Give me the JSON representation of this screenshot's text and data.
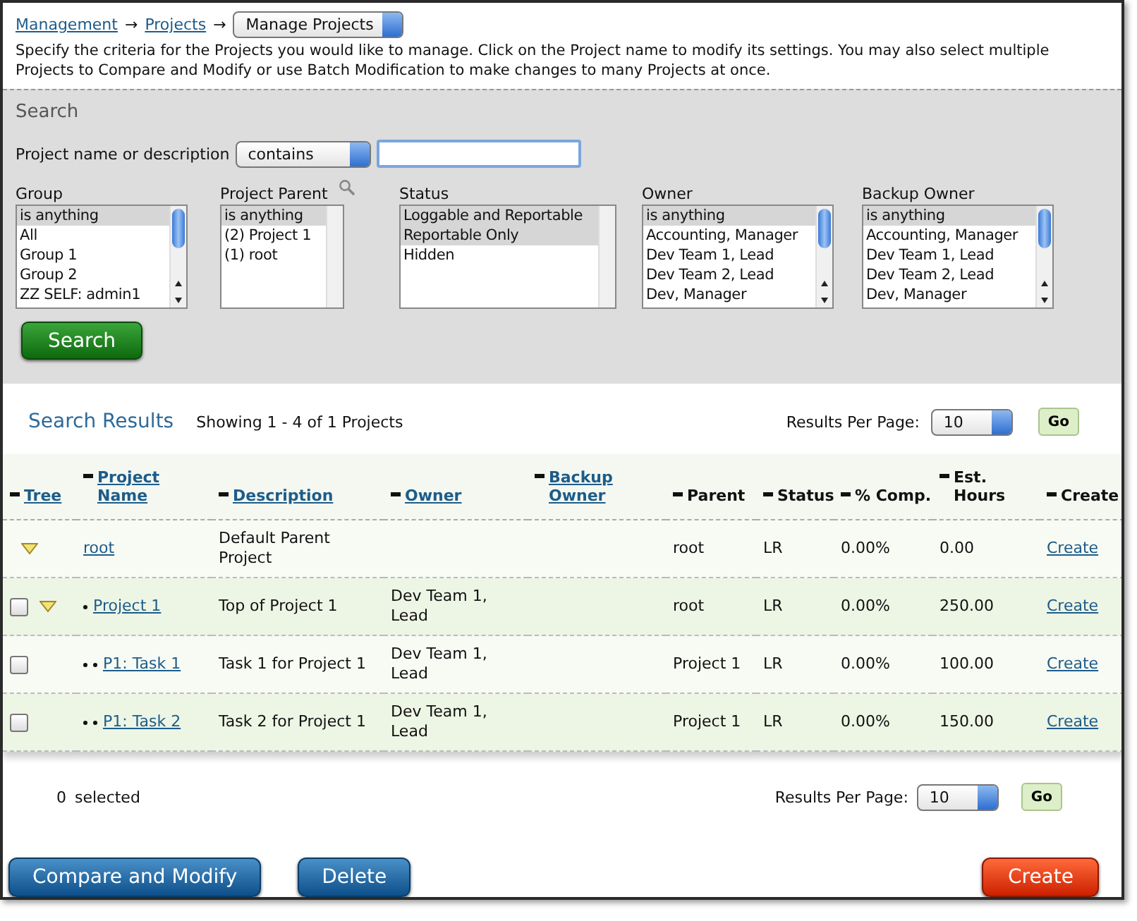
{
  "breadcrumb": {
    "links": [
      "Management",
      "Projects"
    ],
    "separator": "→",
    "current": "Manage Projects"
  },
  "intro": "Specify the criteria for the Projects you would like to manage. Click on the Project name to modify its settings. You may also select multiple Projects to Compare and Modify or use Batch Modification to make changes to many Projects at once.",
  "search": {
    "title": "Search",
    "name_label": "Project name or description",
    "operator": "contains",
    "lists": [
      {
        "label": "Group",
        "lookup": false,
        "items": [
          {
            "text": "is anything",
            "selected": true
          },
          {
            "text": "All",
            "selected": false
          },
          {
            "text": "Group 1",
            "selected": false
          },
          {
            "text": "Group 2",
            "selected": false
          },
          {
            "text": "ZZ SELF: admin1",
            "selected": false
          }
        ]
      },
      {
        "label": "Project Parent",
        "lookup": true,
        "items": [
          {
            "text": "is anything",
            "selected": true
          },
          {
            "text": "(2) Project 1",
            "selected": false
          },
          {
            "text": "(1) root",
            "selected": false
          }
        ]
      },
      {
        "label": "Status",
        "lookup": false,
        "items": [
          {
            "text": "Loggable and Reportable",
            "selected": true
          },
          {
            "text": "Reportable Only",
            "selected": true
          },
          {
            "text": "Hidden",
            "selected": false
          }
        ]
      },
      {
        "label": "Owner",
        "lookup": false,
        "items": [
          {
            "text": "is anything",
            "selected": true
          },
          {
            "text": "Accounting, Manager",
            "selected": false
          },
          {
            "text": "Dev Team 1, Lead",
            "selected": false
          },
          {
            "text": "Dev Team 2, Lead",
            "selected": false
          },
          {
            "text": "Dev, Manager",
            "selected": false
          }
        ]
      },
      {
        "label": "Backup Owner",
        "lookup": false,
        "items": [
          {
            "text": "is anything",
            "selected": true
          },
          {
            "text": "Accounting, Manager",
            "selected": false
          },
          {
            "text": "Dev Team 1, Lead",
            "selected": false
          },
          {
            "text": "Dev Team 2, Lead",
            "selected": false
          },
          {
            "text": "Dev, Manager",
            "selected": false
          }
        ]
      }
    ],
    "button": "Search"
  },
  "results": {
    "title": "Search Results",
    "summary": "Showing 1 - 4 of 1 Projects",
    "per_page_label": "Results Per Page:",
    "per_page": "10",
    "go": "Go",
    "columns": [
      {
        "label": "Tree",
        "link": true
      },
      {
        "label": "Project Name",
        "link": true
      },
      {
        "label": "Description",
        "link": true
      },
      {
        "label": "Owner",
        "link": true
      },
      {
        "label": "Backup Owner",
        "link": true
      },
      {
        "label": "Parent",
        "link": false
      },
      {
        "label": "Status",
        "link": false
      },
      {
        "label": "% Comp.",
        "link": false
      },
      {
        "label": "Est. Hours",
        "link": false
      },
      {
        "label": "Create",
        "link": false
      }
    ],
    "rows": [
      {
        "name": "root",
        "expanded": true,
        "description": "Default Parent Project",
        "parent": "root",
        "status": "LR",
        "comp": "0.00%",
        "hours": "0.00",
        "create": "Create",
        "children": [
          {
            "name": "Project 1",
            "checked": false,
            "expanded": true,
            "description": "Top of Project 1",
            "owner": "Dev Team 1, Lead",
            "parent": "root",
            "status": "LR",
            "comp": "0.00%",
            "hours": "250.00",
            "create": "Create",
            "children": [
              {
                "name": "P1: Task 1",
                "checked": false,
                "description": "Task 1 for Project 1",
                "owner": "Dev Team 1, Lead",
                "parent": "Project 1",
                "status": "LR",
                "comp": "0.00%",
                "hours": "100.00",
                "create": "Create"
              },
              {
                "name": "P1: Task 2",
                "checked": false,
                "description": "Task 2 for Project 1",
                "owner": "Dev Team 1, Lead",
                "parent": "Project 1",
                "status": "LR",
                "comp": "0.00%",
                "hours": "150.00",
                "create": "Create"
              }
            ]
          }
        ]
      }
    ],
    "selected_count": "0",
    "selected_label": "selected",
    "footer_per_page_label": "Results Per Page:",
    "footer_per_page": "10",
    "footer_go": "Go"
  },
  "actions": [
    {
      "label": "Compare and Modify",
      "kind": "primary"
    },
    {
      "label": "Delete",
      "kind": "primary"
    },
    {
      "label": "Create",
      "kind": "danger"
    }
  ]
}
